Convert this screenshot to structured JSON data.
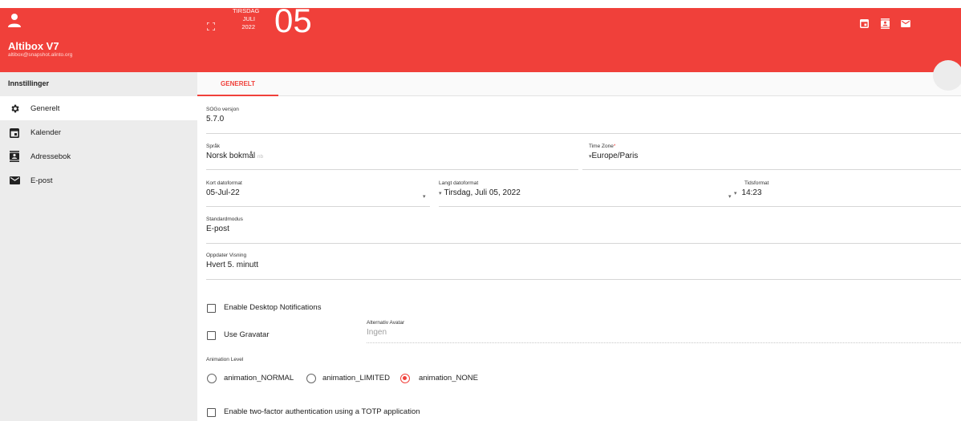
{
  "colors": {
    "accent": "#f0403a",
    "sidebar_bg": "#ececec"
  },
  "sidebar": {
    "app_name": "Altibox V7",
    "email": "altibox@snapshot.alinto.org",
    "section_title": "Innstillinger",
    "items": [
      {
        "label": "Generelt",
        "icon": "gear-icon",
        "active": true
      },
      {
        "label": "Kalender",
        "icon": "calendar-icon",
        "active": false
      },
      {
        "label": "Adressebok",
        "icon": "contacts-icon",
        "active": false
      },
      {
        "label": "E-post",
        "icon": "mail-icon",
        "active": false
      }
    ]
  },
  "header": {
    "weekday": "TIRSDAG",
    "month": "JULI",
    "year": "2022",
    "day": "05",
    "icons": [
      "calendar-icon",
      "contacts-icon",
      "mail-icon"
    ]
  },
  "tabs": [
    {
      "label": "GENERELT",
      "active": true
    }
  ],
  "form": {
    "version": {
      "label": "SOGo versjon",
      "value": "5.7.0"
    },
    "language": {
      "label": "Språk",
      "value": "Norsk bokmål",
      "hint": "nb"
    },
    "timezone": {
      "label": "Time Zone",
      "required_mark": "*",
      "value": "Europe/Paris"
    },
    "short_date": {
      "label": "Kort datoformat",
      "value": "05-Jul-22"
    },
    "long_date": {
      "label": "Langt datoformat",
      "value": "Tirsdag, Juli 05, 2022"
    },
    "time_format": {
      "label": "Tidsformat",
      "value": "14:23"
    },
    "default_module": {
      "label": "Standardmodus",
      "value": "E-post"
    },
    "refresh": {
      "label": "Oppdater Visning",
      "value": "Hvert 5. minutt"
    },
    "desktop_notifications": {
      "label": "Enable Desktop Notifications",
      "checked": false
    },
    "gravatar": {
      "label": "Use Gravatar",
      "checked": false
    },
    "alt_avatar": {
      "label": "Alternativ Avatar",
      "value": "Ingen"
    },
    "animation": {
      "label": "Animation Level",
      "options": [
        "animation_NORMAL",
        "animation_LIMITED",
        "animation_NONE"
      ],
      "selected": "animation_NONE"
    },
    "two_factor": {
      "label": "Enable two-factor authentication using a TOTP application",
      "checked": false
    }
  }
}
